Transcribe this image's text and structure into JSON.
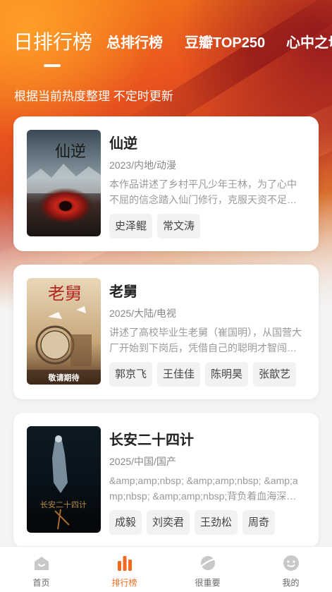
{
  "tabs": [
    {
      "label": "日排行榜",
      "active": true
    },
    {
      "label": "总排行榜",
      "active": false
    },
    {
      "label": "豆瓣TOP250",
      "active": false
    },
    {
      "label": "心中之切",
      "active": false
    }
  ],
  "subtitle": "根据当前热度整理 不定时更新",
  "cards": [
    {
      "title": "仙逆",
      "meta": "2023/内地/动漫",
      "desc": "本作品讲述了乡村平凡少年王林，为了心中不屈的信念踏入仙门修行，克服天资不足的困难，一步步走向巅峰。",
      "actors": [
        "史泽鲲",
        "常文涛"
      ],
      "poster_text": "仙逆"
    },
    {
      "title": "老舅",
      "meta": "2025/大陆/电视",
      "desc": "讲述了高校毕业生老舅（崔国明），从国营大厂开始到下岗后，凭借自己的聪明才智闯出一片天地的故事。",
      "actors": [
        "郭京飞",
        "王佳佳",
        "陈明昊",
        "张歆艺"
      ],
      "poster_text": "老舅",
      "poster_badge": "敬请期待"
    },
    {
      "title": "长安二十四计",
      "meta": "2025/中国/国产",
      "desc": "&amp;amp;nbsp; &amp;amp;nbsp; &amp;amp;nbsp; &amp;amp;nbsp;背负着血海深仇的谢淮安隐姓埋名",
      "actors": [
        "成毅",
        "刘奕君",
        "王劲松",
        "周奇"
      ],
      "poster_text": "长安二十四计"
    }
  ],
  "nav": [
    {
      "label": "首页",
      "icon": "home-icon",
      "active": false
    },
    {
      "label": "排行榜",
      "icon": "ranking-icon",
      "active": true
    },
    {
      "label": "很重要",
      "icon": "planet-icon",
      "active": false
    },
    {
      "label": "我的",
      "icon": "smiley-icon",
      "active": false
    }
  ],
  "colors": {
    "accent": "#f26a20",
    "nav_inactive": "#c8c8c8"
  }
}
